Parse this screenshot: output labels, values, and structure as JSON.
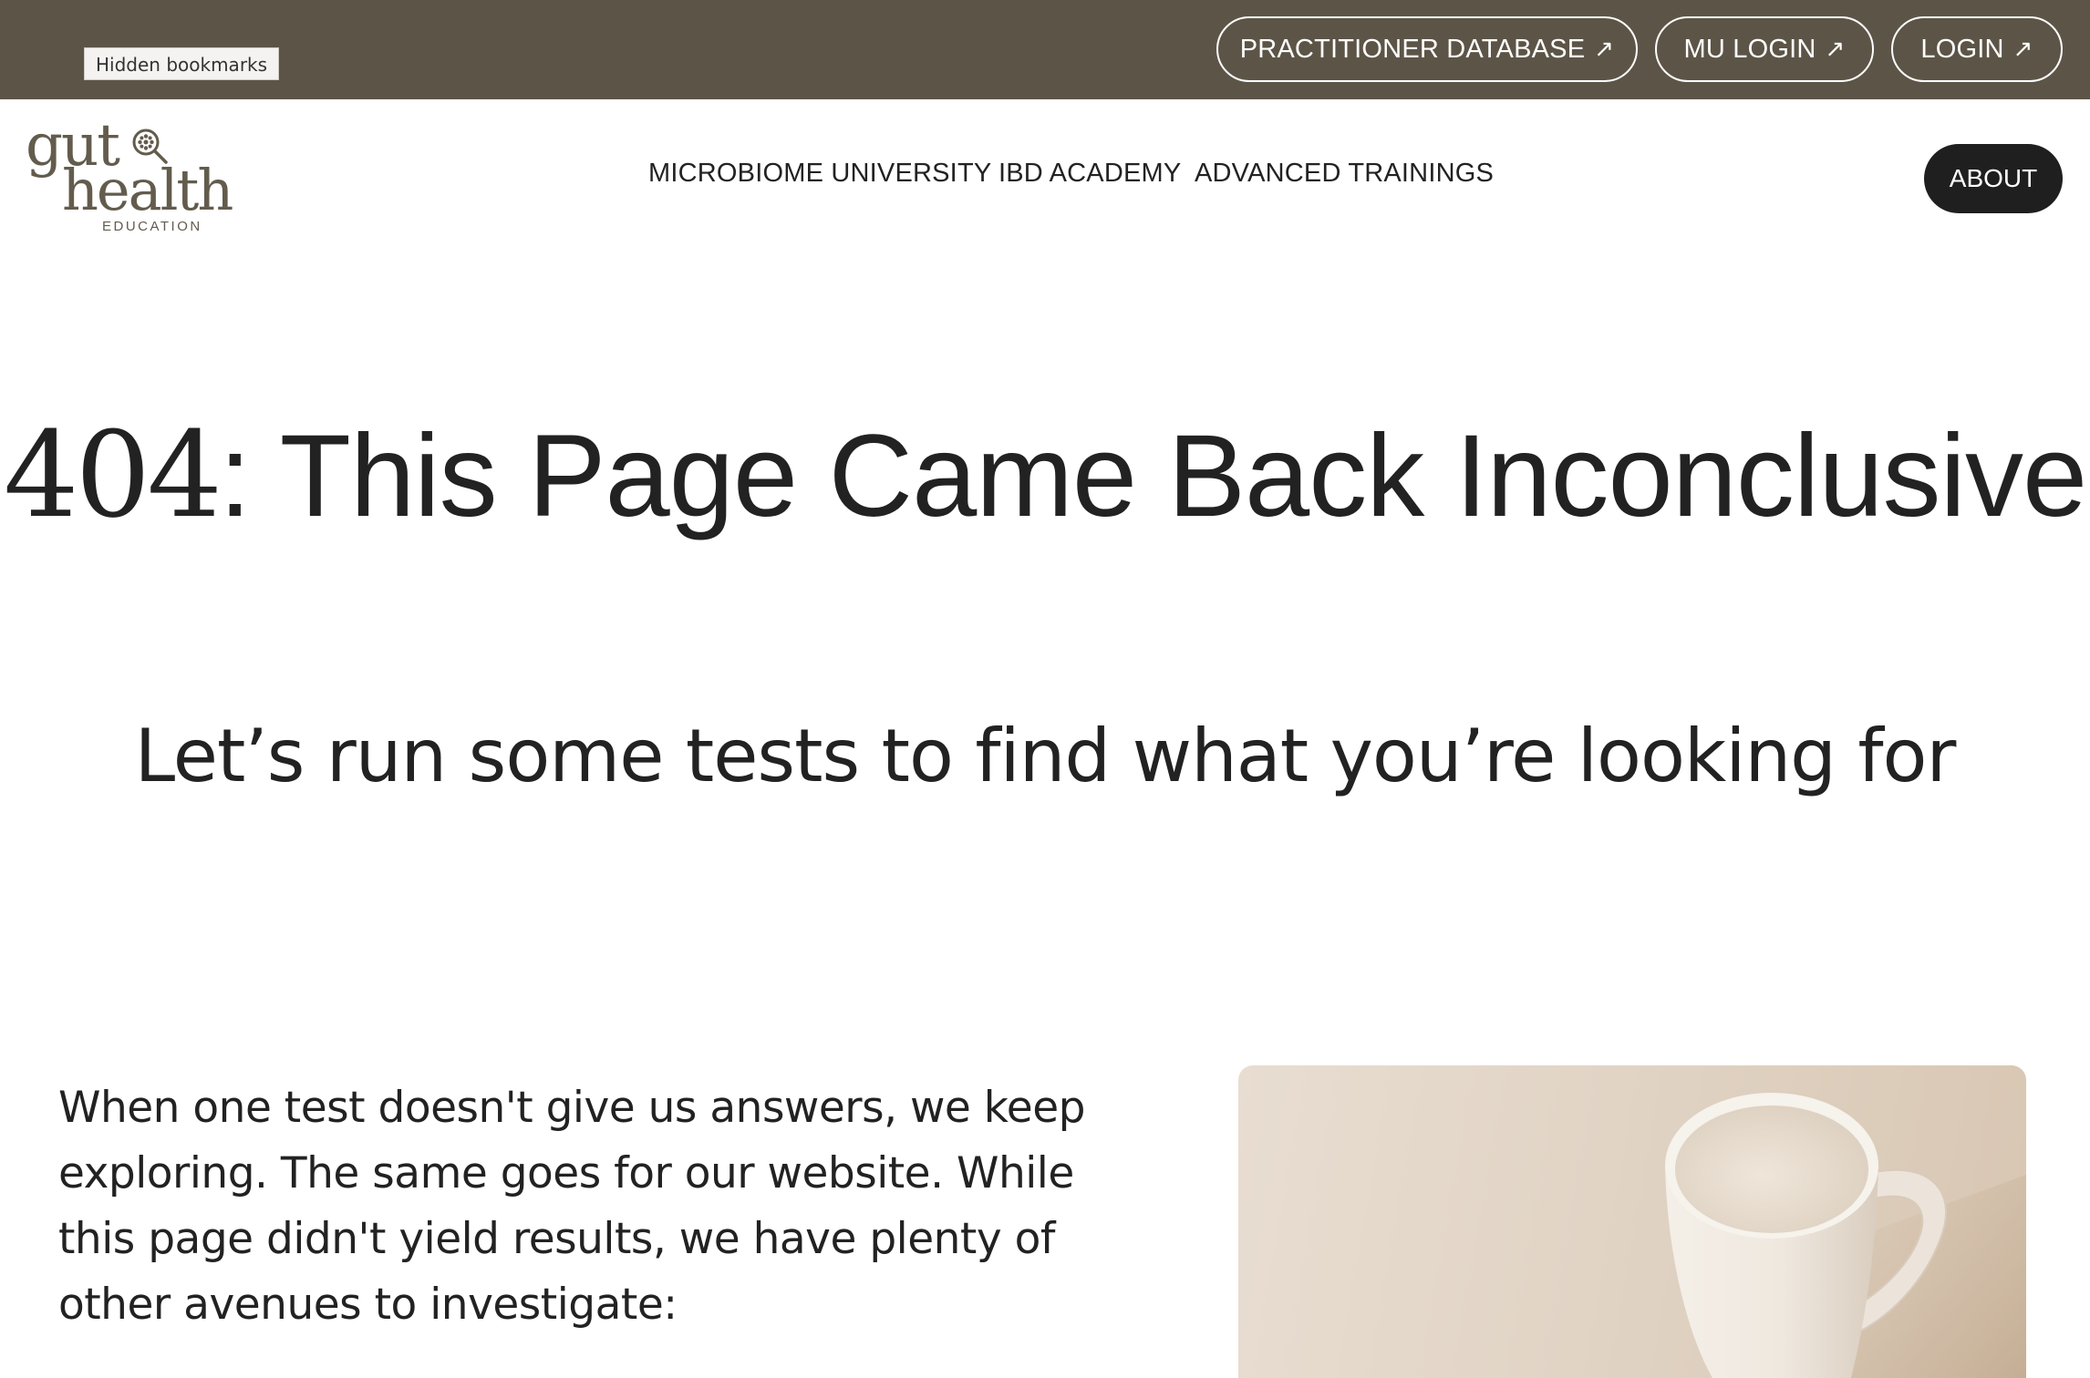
{
  "browser": {
    "bookmarks_label": "Hidden bookmarks"
  },
  "topbar": {
    "background_color": "#5c5547",
    "links": [
      {
        "label": "PRACTITIONER DATABASE",
        "icon": "external-arrow-icon"
      },
      {
        "label": "MU LOGIN",
        "icon": "external-arrow-icon"
      },
      {
        "label": "LOGIN",
        "icon": "external-arrow-icon"
      }
    ],
    "arrow_glyph": "↗"
  },
  "logo": {
    "line1": "gut",
    "line2": "health",
    "line3": "EDUCATION",
    "color": "#635c4d"
  },
  "nav": {
    "items": [
      {
        "label": "MICROBIOME UNIVERSITY"
      },
      {
        "label": "IBD ACADEMY"
      },
      {
        "label": "ADVANCED TRAININGS"
      }
    ],
    "about_label": "ABOUT"
  },
  "hero": {
    "code": "404",
    "title_rest": ": This Page Came Back Inconclusive",
    "subtitle": "Let’s run some tests to find what you’re looking for"
  },
  "content": {
    "intro": "When one test doesn't give us answers, we keep exploring. The same goes for our website. While this page didn't yield results, we have plenty of other avenues to investigate:",
    "image_subject": "white-ceramic-mug"
  }
}
